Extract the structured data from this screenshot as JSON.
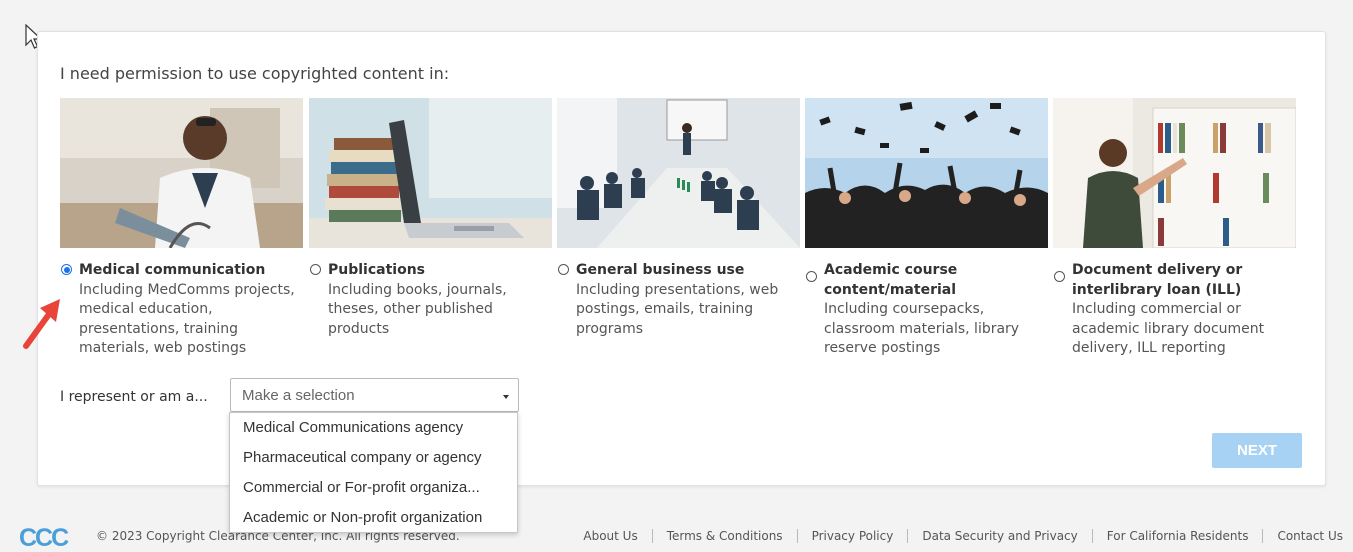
{
  "heading": "I need permission to use copyrighted content in:",
  "options": [
    {
      "title": "Medical communication",
      "description": "Including MedComms projects, medical education, presentations, training materials, web postings",
      "selected": true
    },
    {
      "title": "Publications",
      "description": "Including books, journals, theses, other published products",
      "selected": false
    },
    {
      "title": "General business use",
      "description": "Including presentations, web postings, emails, training programs",
      "selected": false
    },
    {
      "title": "Academic course content/material",
      "description": "Including coursepacks, classroom materials, library reserve postings",
      "selected": false
    },
    {
      "title": "Document delivery or interlibrary loan (ILL)",
      "description": "Including commercial or academic library document delivery, ILL reporting",
      "selected": false
    }
  ],
  "represent": {
    "label": "I represent or am a...",
    "placeholder": "Make a selection",
    "dropdown_options": [
      "Medical Communications agency",
      "Pharmaceutical company or agency",
      "Commercial or For-profit organiza...",
      "Academic or Non-profit organization"
    ]
  },
  "next_label": "NEXT",
  "footer": {
    "logo_text": "CCC",
    "copyright": "© 2023 Copyright Clearance Center, Inc. All rights reserved.",
    "links": [
      "About Us",
      "Terms & Conditions",
      "Privacy Policy",
      "Data Security and Privacy",
      "For California Residents",
      "Contact Us"
    ]
  },
  "colors": {
    "accent": "#1a73e8",
    "next_button": "#a8d2f3",
    "logo": "#4a9fd8",
    "arrow": "#e8443a"
  }
}
